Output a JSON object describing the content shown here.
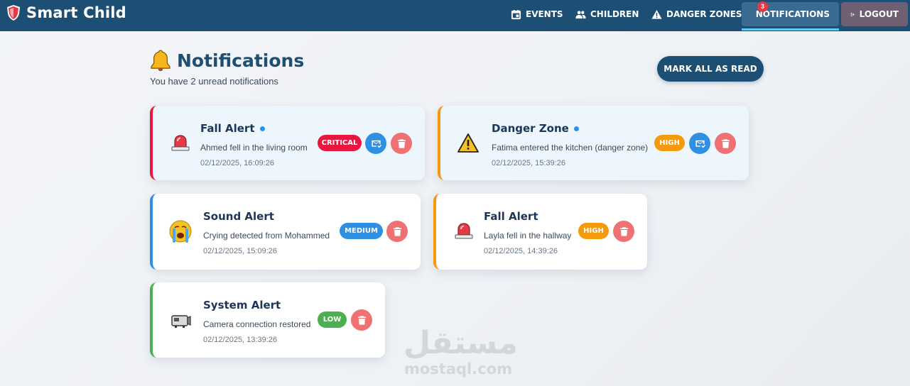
{
  "app": {
    "title": "Smart Child"
  },
  "nav": {
    "events": "EVENTS",
    "children": "CHILDREN",
    "danger_zones": "DANGER ZONES",
    "notifications": "NOTIFICATIONS",
    "notification_count": "3",
    "logout": "LOGOUT"
  },
  "page": {
    "title": "Notifications",
    "subtitle": "You have 2 unread notifications",
    "mark_all_label": "MARK ALL AS READ"
  },
  "colors": {
    "navbar": "#1d4e73",
    "critical": "#e8173f",
    "high": "#f59a0c",
    "medium": "#2f8fe0",
    "low": "#4caf50"
  },
  "notifications": [
    {
      "icon": "siren-icon",
      "title": "Fall Alert",
      "message": "Ahmed fell in the living room",
      "time": "02/12/2025, 16:09:26",
      "severity": "CRITICAL",
      "unread": true
    },
    {
      "icon": "warning-icon",
      "title": "Danger Zone",
      "message": "Fatima entered the kitchen (danger zone)",
      "time": "02/12/2025, 15:39:26",
      "severity": "HIGH",
      "unread": true
    },
    {
      "icon": "crying-face-icon",
      "title": "Sound Alert",
      "message": "Crying detected from Mohammed",
      "time": "02/12/2025, 15:09:26",
      "severity": "MEDIUM",
      "unread": false
    },
    {
      "icon": "siren-icon",
      "title": "Fall Alert",
      "message": "Layla fell in the hallway",
      "time": "02/12/2025, 14:39:26",
      "severity": "HIGH",
      "unread": false
    },
    {
      "icon": "video-camera-icon",
      "title": "System Alert",
      "message": "Camera connection restored",
      "time": "02/12/2025, 13:39:26",
      "severity": "LOW",
      "unread": false
    }
  ],
  "watermark": {
    "arabic": "مستقل",
    "latin": "mostaql.com"
  }
}
